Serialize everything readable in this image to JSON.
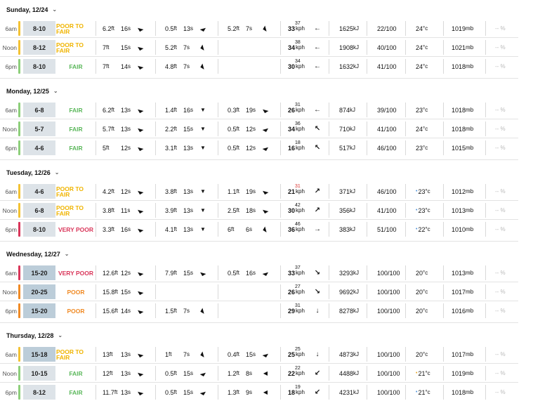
{
  "days": [
    {
      "header": "Sunday, 12/24",
      "rows": [
        {
          "time": "6am",
          "bar": "#f3c233",
          "range": "8-10",
          "big": false,
          "rating": "POOR TO FAIR",
          "rating_color": "#f0b400",
          "s1h": "6.2",
          "s1p": "16",
          "s1a": "nw",
          "s2h": "0.5",
          "s2p": "13",
          "s2a": "ne",
          "s3h": "5.2",
          "s3p": "7",
          "s3a": "e",
          "wind": "33",
          "gust": "37",
          "gust_red": false,
          "wdir": "w",
          "energy": "1625",
          "cons": "22/100",
          "temp": "24",
          "dot": "",
          "pres": "1019"
        },
        {
          "time": "Noon",
          "bar": "#f3c233",
          "range": "8-12",
          "big": false,
          "rating": "POOR TO FAIR",
          "rating_color": "#f0b400",
          "s1h": "7",
          "s1p": "15",
          "s1a": "nw",
          "s2h": "5.2",
          "s2p": "7",
          "s2a": "e",
          "s3h": "",
          "s3p": "",
          "s3a": "",
          "wind": "34",
          "gust": "38",
          "gust_red": false,
          "wdir": "w",
          "energy": "1908",
          "cons": "40/100",
          "temp": "24",
          "dot": "",
          "pres": "1021"
        },
        {
          "time": "6pm",
          "bar": "#8dcf7a",
          "range": "8-10",
          "big": false,
          "rating": "FAIR",
          "rating_color": "#5cb85c",
          "s1h": "7",
          "s1p": "14",
          "s1a": "nw",
          "s2h": "4.8",
          "s2p": "7",
          "s2a": "e",
          "s3h": "",
          "s3p": "",
          "s3a": "",
          "wind": "30",
          "gust": "34",
          "gust_red": false,
          "wdir": "w",
          "energy": "1632",
          "cons": "41/100",
          "temp": "24",
          "dot": "",
          "pres": "1018"
        }
      ]
    },
    {
      "header": "Monday, 12/25",
      "rows": [
        {
          "time": "6am",
          "bar": "#8dcf7a",
          "range": "6-8",
          "big": false,
          "rating": "FAIR",
          "rating_color": "#5cb85c",
          "s1h": "6.2",
          "s1p": "13",
          "s1a": "nw",
          "s2h": "1.4",
          "s2p": "16",
          "s2a": "n",
          "s3h": "0.3",
          "s3p": "19",
          "s3a": "nw",
          "wind": "26",
          "gust": "31",
          "gust_red": false,
          "wdir": "w",
          "energy": "874",
          "cons": "39/100",
          "temp": "23",
          "dot": "",
          "pres": "1018"
        },
        {
          "time": "Noon",
          "bar": "#8dcf7a",
          "range": "5-7",
          "big": false,
          "rating": "FAIR",
          "rating_color": "#5cb85c",
          "s1h": "5.7",
          "s1p": "13",
          "s1a": "nw",
          "s2h": "2.2",
          "s2p": "15",
          "s2a": "n",
          "s3h": "0.5",
          "s3p": "12",
          "s3a": "ne",
          "wind": "34",
          "gust": "36",
          "gust_red": false,
          "wdir": "nw",
          "energy": "710",
          "cons": "41/100",
          "temp": "24",
          "dot": "",
          "pres": "1018"
        },
        {
          "time": "6pm",
          "bar": "#8dcf7a",
          "range": "4-6",
          "big": false,
          "rating": "FAIR",
          "rating_color": "#5cb85c",
          "s1h": "5",
          "s1p": "12",
          "s1a": "nw",
          "s2h": "3.1",
          "s2p": "13",
          "s2a": "n",
          "s3h": "0.5",
          "s3p": "12",
          "s3a": "ne",
          "wind": "16",
          "gust": "18",
          "gust_red": false,
          "wdir": "nw",
          "energy": "517",
          "cons": "46/100",
          "temp": "23",
          "dot": "",
          "pres": "1015"
        }
      ]
    },
    {
      "header": "Tuesday, 12/26",
      "rows": [
        {
          "time": "6am",
          "bar": "#f3c233",
          "range": "4-6",
          "big": false,
          "rating": "POOR TO FAIR",
          "rating_color": "#f0b400",
          "s1h": "4.2",
          "s1p": "12",
          "s1a": "nw",
          "s2h": "3.8",
          "s2p": "13",
          "s2a": "n",
          "s3h": "1.1",
          "s3p": "19",
          "s3a": "nw",
          "wind": "21",
          "gust": "31",
          "gust_red": true,
          "wdir": "ne",
          "energy": "371",
          "cons": "46/100",
          "temp": "23",
          "dot": "blue",
          "pres": "1012"
        },
        {
          "time": "Noon",
          "bar": "#f3c233",
          "range": "6-8",
          "big": false,
          "rating": "POOR TO FAIR",
          "rating_color": "#f0b400",
          "s1h": "3.8",
          "s1p": "11",
          "s1a": "nw",
          "s2h": "3.9",
          "s2p": "13",
          "s2a": "n",
          "s3h": "2.5",
          "s3p": "18",
          "s3a": "nw",
          "wind": "30",
          "gust": "42",
          "gust_red": false,
          "wdir": "ne",
          "energy": "356",
          "cons": "41/100",
          "temp": "23",
          "dot": "blue",
          "pres": "1013"
        },
        {
          "time": "6pm",
          "bar": "#d9365a",
          "range": "8-10",
          "big": false,
          "rating": "VERY POOR",
          "rating_color": "#d9365a",
          "s1h": "3.3",
          "s1p": "16",
          "s1a": "nw",
          "s2h": "4.1",
          "s2p": "13",
          "s2a": "n",
          "s3h": "6",
          "s3p": "6",
          "s3a": "e",
          "wind": "36",
          "gust": "46",
          "gust_red": false,
          "wdir": "e",
          "energy": "383",
          "cons": "51/100",
          "temp": "22",
          "dot": "blue",
          "pres": "1010"
        }
      ]
    },
    {
      "header": "Wednesday, 12/27",
      "rows": [
        {
          "time": "6am",
          "bar": "#d9365a",
          "range": "15-20",
          "big": true,
          "rating": "VERY POOR",
          "rating_color": "#d9365a",
          "s1h": "12.6",
          "s1p": "12",
          "s1a": "nw",
          "s2h": "7.9",
          "s2p": "15",
          "s2a": "nw",
          "s3h": "0.5",
          "s3p": "16",
          "s3a": "ne",
          "wind": "33",
          "gust": "37",
          "gust_red": false,
          "wdir": "se",
          "energy": "3293",
          "cons": "100/100",
          "temp": "20",
          "dot": "",
          "pres": "1013"
        },
        {
          "time": "Noon",
          "bar": "#f08a24",
          "range": "20-25",
          "big": true,
          "rating": "POOR",
          "rating_color": "#f08a24",
          "s1h": "15.8",
          "s1p": "15",
          "s1a": "nw",
          "s2h": "",
          "s2p": "",
          "s2a": "",
          "s3h": "",
          "s3p": "",
          "s3a": "",
          "wind": "26",
          "gust": "27",
          "gust_red": false,
          "wdir": "se",
          "energy": "9692",
          "cons": "100/100",
          "temp": "20",
          "dot": "",
          "pres": "1017"
        },
        {
          "time": "6pm",
          "bar": "#f08a24",
          "range": "15-20",
          "big": true,
          "rating": "POOR",
          "rating_color": "#f08a24",
          "s1h": "15.6",
          "s1p": "14",
          "s1a": "nw",
          "s2h": "1.5",
          "s2p": "7",
          "s2a": "e",
          "s3h": "",
          "s3p": "",
          "s3a": "",
          "wind": "29",
          "gust": "31",
          "gust_red": false,
          "wdir": "s",
          "energy": "8278",
          "cons": "100/100",
          "temp": "20",
          "dot": "",
          "pres": "1016"
        }
      ]
    },
    {
      "header": "Thursday, 12/28",
      "rows": [
        {
          "time": "6am",
          "bar": "#f3c233",
          "range": "15-18",
          "big": true,
          "rating": "POOR TO FAIR",
          "rating_color": "#f0b400",
          "s1h": "13",
          "s1p": "13",
          "s1a": "nw",
          "s2h": "1",
          "s2p": "7",
          "s2a": "e",
          "s3h": "0.4",
          "s3p": "15",
          "s3a": "ne",
          "wind": "25",
          "gust": "25",
          "gust_red": false,
          "wdir": "s",
          "energy": "4873",
          "cons": "100/100",
          "temp": "20",
          "dot": "",
          "pres": "1017"
        },
        {
          "time": "Noon",
          "bar": "#8dcf7a",
          "range": "10-15",
          "big": false,
          "rating": "FAIR",
          "rating_color": "#5cb85c",
          "s1h": "12",
          "s1p": "13",
          "s1a": "nw",
          "s2h": "0.5",
          "s2p": "15",
          "s2a": "ne",
          "s3h": "1.2",
          "s3p": "8",
          "s3a": "w",
          "wind": "22",
          "gust": "22",
          "gust_red": false,
          "wdir": "sw",
          "energy": "4488",
          "cons": "100/100",
          "temp": "21",
          "dot": "orange",
          "pres": "1019"
        },
        {
          "time": "6pm",
          "bar": "#8dcf7a",
          "range": "8-12",
          "big": false,
          "rating": "FAIR",
          "rating_color": "#5cb85c",
          "s1h": "11.7",
          "s1p": "13",
          "s1a": "nw",
          "s2h": "0.5",
          "s2p": "15",
          "s2a": "ne",
          "s3h": "1.3",
          "s3p": "9",
          "s3a": "w",
          "wind": "18",
          "gust": "19",
          "gust_red": false,
          "wdir": "sw",
          "energy": "4231",
          "cons": "100/100",
          "temp": "21",
          "dot": "blue",
          "pres": "1018"
        }
      ]
    }
  ],
  "units": {
    "height": "ft",
    "period": "s",
    "wind": "kph",
    "energy": "kJ",
    "temp": "°c",
    "pressure": "mb",
    "pct": "-- %"
  },
  "icons": {
    "chevron": "chevron-down-icon",
    "swell_arrow": "swell-direction-icon",
    "wind_arrow": "wind-direction-icon"
  }
}
